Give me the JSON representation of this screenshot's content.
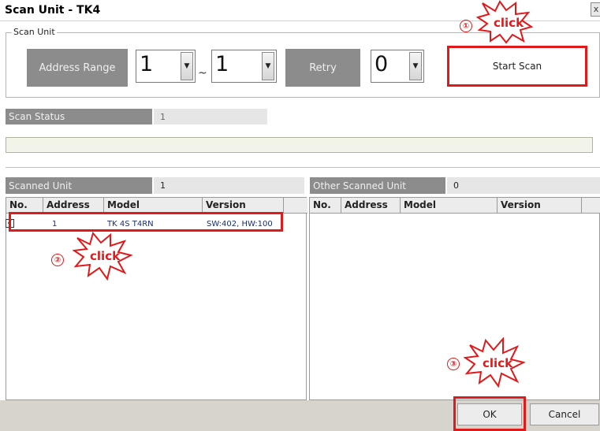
{
  "window": {
    "title": "Scan Unit  - TK4",
    "close_glyph": "x"
  },
  "scan_unit": {
    "group_label": "Scan Unit",
    "address_range_label": "Address Range",
    "address_from": "1",
    "range_separator": "~",
    "address_to": "1",
    "retry_label": "Retry",
    "retry_value": "0",
    "start_scan_label": "Start Scan"
  },
  "scan_status": {
    "label": "Scan Status",
    "value": "1"
  },
  "scanned_unit": {
    "label": "Scanned Unit",
    "count": "1",
    "columns": [
      "No.",
      "Address",
      "Model",
      "Version"
    ],
    "rows": [
      {
        "checked": true,
        "check_glyph": "✓",
        "address": "1",
        "model": "TK 4S T4RN",
        "version": "SW:402, HW:100"
      }
    ]
  },
  "other_scanned_unit": {
    "label": "Other Scanned Unit",
    "count": "0",
    "columns": [
      "No.",
      "Address",
      "Model",
      "Version"
    ]
  },
  "buttons": {
    "ok": "OK",
    "cancel": "Cancel"
  },
  "annotations": {
    "step1_number": "①",
    "step2_number": "②",
    "step3_number": "③",
    "click_text": "click",
    "highlight_color": "#e01a1a"
  },
  "icons": {
    "dropdown": "chevron-down-icon",
    "checkbox": "checkbox-icon"
  },
  "colors": {
    "label_gray": "#8c8c8c",
    "status_value_bg": "#e6e6e6",
    "progress_bg": "#f2f4ea",
    "bottom_bar": "#d7d4ce",
    "annotation_red": "#e01a1a"
  }
}
